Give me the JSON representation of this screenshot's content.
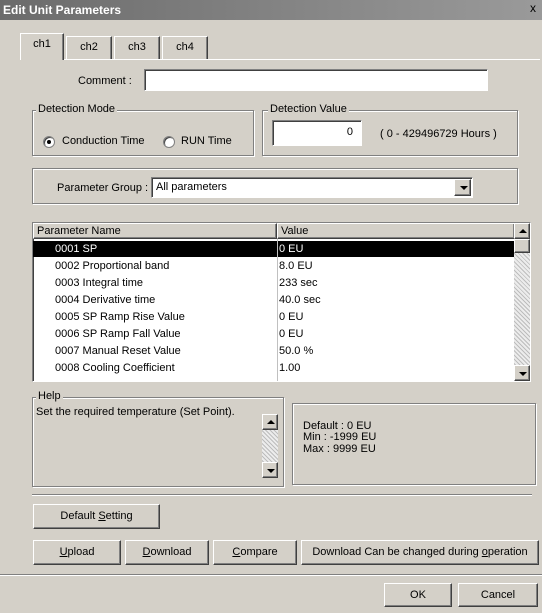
{
  "window": {
    "title": "Edit Unit Parameters",
    "close_glyph": "x"
  },
  "tabs": [
    {
      "label": "ch1"
    },
    {
      "label": "ch2"
    },
    {
      "label": "ch3"
    },
    {
      "label": "ch4"
    }
  ],
  "comment": {
    "label": "Comment :",
    "value": ""
  },
  "detection_mode": {
    "title": "Detection Mode",
    "options": [
      {
        "label": "Conduction Time",
        "selected": true
      },
      {
        "label": "RUN Time",
        "selected": false
      }
    ]
  },
  "detection_value": {
    "title": "Detection Value",
    "value": "0",
    "range": "( 0 - 429496729 Hours )"
  },
  "parameter_group": {
    "label": "Parameter Group :",
    "selected": "All parameters"
  },
  "parameters_table": {
    "columns": [
      "Parameter Name",
      "Value"
    ],
    "rows": [
      {
        "name": "0001 SP",
        "value": "0 EU",
        "selected": true
      },
      {
        "name": "0002 Proportional band",
        "value": "8.0 EU"
      },
      {
        "name": "0003 Integral time",
        "value": "233 sec"
      },
      {
        "name": "0004 Derivative time",
        "value": "40.0 sec"
      },
      {
        "name": "0005 SP Ramp Rise Value",
        "value": "0 EU"
      },
      {
        "name": "0006 SP Ramp Fall Value",
        "value": "0 EU"
      },
      {
        "name": "0007 Manual Reset Value",
        "value": "50.0 %"
      },
      {
        "name": "0008 Cooling Coefficient",
        "value": "1.00"
      }
    ]
  },
  "help": {
    "title": "Help",
    "text": "Set the required temperature (Set Point).",
    "default": "Default : 0 EU",
    "min": "Min : -1999 EU",
    "max": "Max : 9999 EU"
  },
  "buttons": {
    "default_setting_pre": "Default ",
    "default_setting_key": "S",
    "default_setting_post": "etting",
    "upload_key": "U",
    "upload_post": "pload",
    "download_key": "D",
    "download_post": "ownload",
    "compare_key": "C",
    "compare_post": "ompare",
    "download_op_pre": "Download Can be changed during ",
    "download_op_key": "o",
    "download_op_post": "peration",
    "ok": "OK",
    "cancel": "Cancel"
  }
}
